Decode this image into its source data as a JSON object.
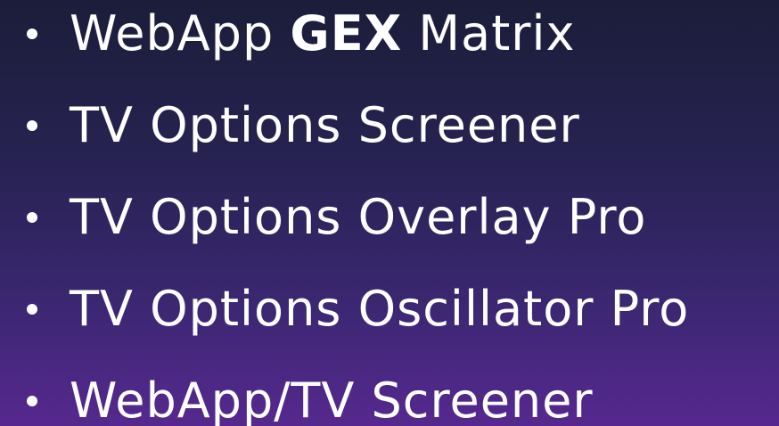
{
  "items": [
    {
      "prefix": "WebApp ",
      "bold": "GEX",
      "suffix": " Matrix"
    },
    {
      "label": "TV Options Screener"
    },
    {
      "label": "TV Options Overlay Pro"
    },
    {
      "label": "TV Options Oscillator Pro"
    },
    {
      "label": "WebApp/TV Screener"
    }
  ],
  "colors": {
    "text": "#ffffff",
    "background_top": "#1b1d3a",
    "background_bottom": "#56288f"
  }
}
